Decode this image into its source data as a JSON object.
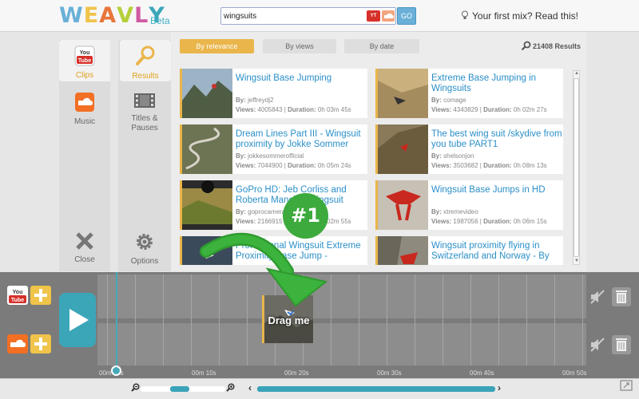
{
  "header": {
    "logo": "WEAVLY",
    "beta": "Beta",
    "search": {
      "value": "wingsuits",
      "go_label": "GO"
    },
    "source_youtube": "You Tube",
    "first_mix": "Your first mix? Read this!"
  },
  "sidebar": {
    "clips": "Clips",
    "results": "Results",
    "music": "Music",
    "titles": "Titles &\nPauses",
    "close": "Close",
    "options": "Options"
  },
  "sort_tabs": [
    "By relevance",
    "By views",
    "By date"
  ],
  "results_count": "21408 Results",
  "meta_labels": {
    "by": "By:",
    "views": "Views:",
    "duration": "Duration:"
  },
  "results": [
    {
      "title": "Wingsuit Base Jumping",
      "by": "jeffreydj2",
      "views": "4005843",
      "duration": "0h 03m 45s",
      "thumb": "mountain-jumper"
    },
    {
      "title": "Extreme Base Jumping in Wingsuits",
      "by": "comage",
      "views": "4343829",
      "duration": "0h 02m 27s",
      "thumb": "cliff-face"
    },
    {
      "title": "Dream Lines Part III - Wingsuit proximity by Jokke Sommer",
      "by": "jokkesommerofficial",
      "views": "7044900",
      "duration": "0h 05m 24s",
      "thumb": "serpentine-road"
    },
    {
      "title": "The best wing suit /skydive from you tube PART1",
      "by": "shelsonjon",
      "views": "3503682",
      "duration": "0h 08m 13s",
      "thumb": "red-jumper-cliff"
    },
    {
      "title": "GoPro HD: Jeb Corliss and Roberta Mancino Wingsuit",
      "by": "goprocamera",
      "views": "2166915",
      "duration": "0h 02m 55s",
      "thumb": "valley-green"
    },
    {
      "title": "Wingsuit Base Jumps in HD",
      "by": "xtremevideo",
      "views": "1987056",
      "duration": "0h 06m 15s",
      "thumb": "red-wingsuit"
    },
    {
      "title": "Professional Wingsuit Extreme Proximity Base Jump -",
      "by": "",
      "views": "",
      "duration": "",
      "thumb": "sky-flyer"
    },
    {
      "title": "Wingsuit proximity flying in Switzerland and Norway - By",
      "by": "",
      "views": "",
      "duration": "",
      "thumb": "red-suit-cliff"
    }
  ],
  "timeline": {
    "ticks": [
      "00m 00s",
      "00m 10s",
      "00m 20s",
      "00m 30s",
      "00m 40s",
      "00m 50s"
    ],
    "drag_clip_label": "Drag me",
    "badge": "#1"
  },
  "zoom": {
    "level": 0.45
  },
  "colors": {
    "accent": "#eab54b",
    "teal": "#3ca6b9",
    "link": "#2a8fc8",
    "badge": "#3caa3c"
  }
}
